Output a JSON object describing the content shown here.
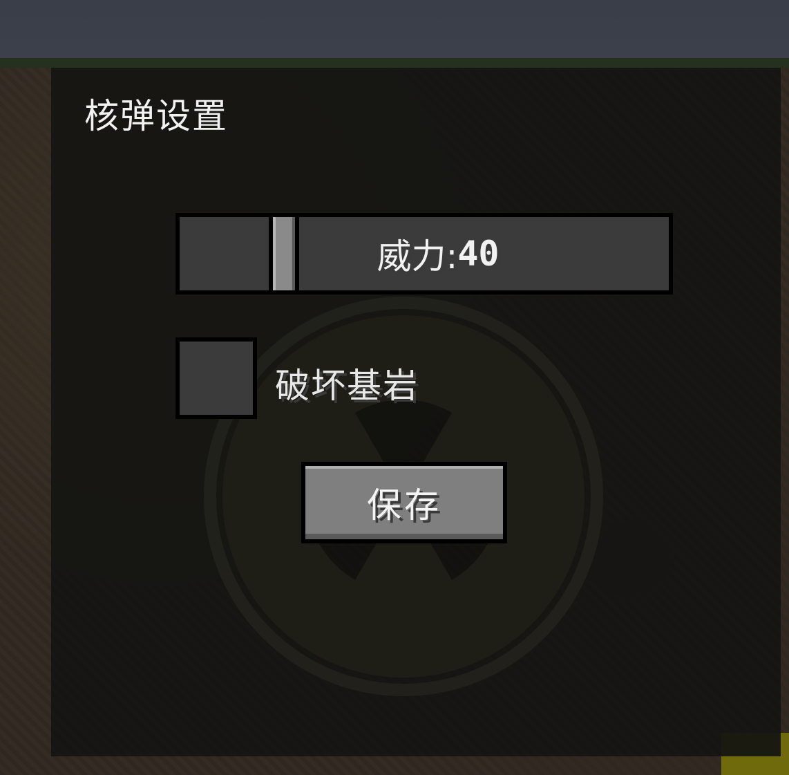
{
  "dialog": {
    "title": "核弹设置"
  },
  "power_slider": {
    "label": "威力: ",
    "value": "40",
    "handle_fraction": 0.2
  },
  "bedrock_checkbox": {
    "label": "破坏基岩",
    "checked": false
  },
  "save_button": {
    "label": "保存"
  },
  "colors": {
    "panel_bg": "#141412",
    "widget_bg": "#3b3b3b",
    "button_bg": "#7f7f7f",
    "emblem_yellow": "#4a4a08",
    "text": "#f2f2f2"
  },
  "icons": {
    "emblem": "radiation-symbol-icon"
  }
}
